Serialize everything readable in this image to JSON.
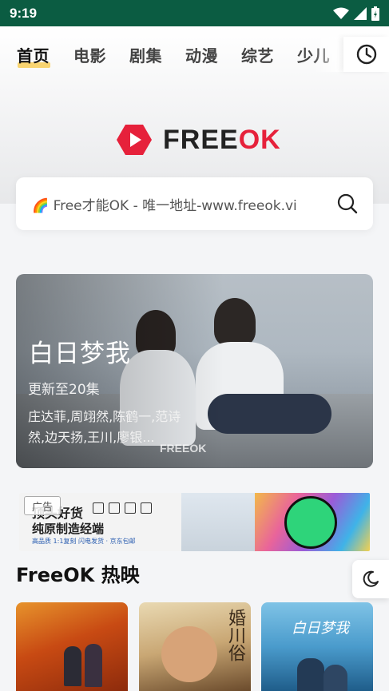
{
  "status_bar": {
    "time": "9:19"
  },
  "nav": {
    "tabs": [
      "首页",
      "电影",
      "剧集",
      "动漫",
      "综艺",
      "少儿"
    ],
    "active_index": 0,
    "history_icon": "clock-icon"
  },
  "logo": {
    "text_free": "FREE",
    "text_ok": "OK",
    "brand_color": "#e6213b"
  },
  "search": {
    "placeholder": "🌈 Free才能OK - 唯一地址-www.freeok.vi"
  },
  "featured": {
    "title": "白日梦我",
    "subtitle": "更新至20集",
    "cast": "庄达菲,周翊然,陈鹤一,范诗然,边天扬,王川,廖银...",
    "watermark": "FREEOK"
  },
  "ad": {
    "badge": "广告",
    "line1": "顶头好货",
    "line2": "纯原制造经端",
    "line3": "高品质 1:1复刻  闪电发货 · 京东包邮"
  },
  "section": {
    "title": "FreeOK 热映"
  },
  "posters": [
    {
      "name": "poster-1"
    },
    {
      "name": "poster-2",
      "overlay_text": "婚川俗"
    },
    {
      "name": "poster-3",
      "overlay_text": "白日梦我"
    }
  ]
}
